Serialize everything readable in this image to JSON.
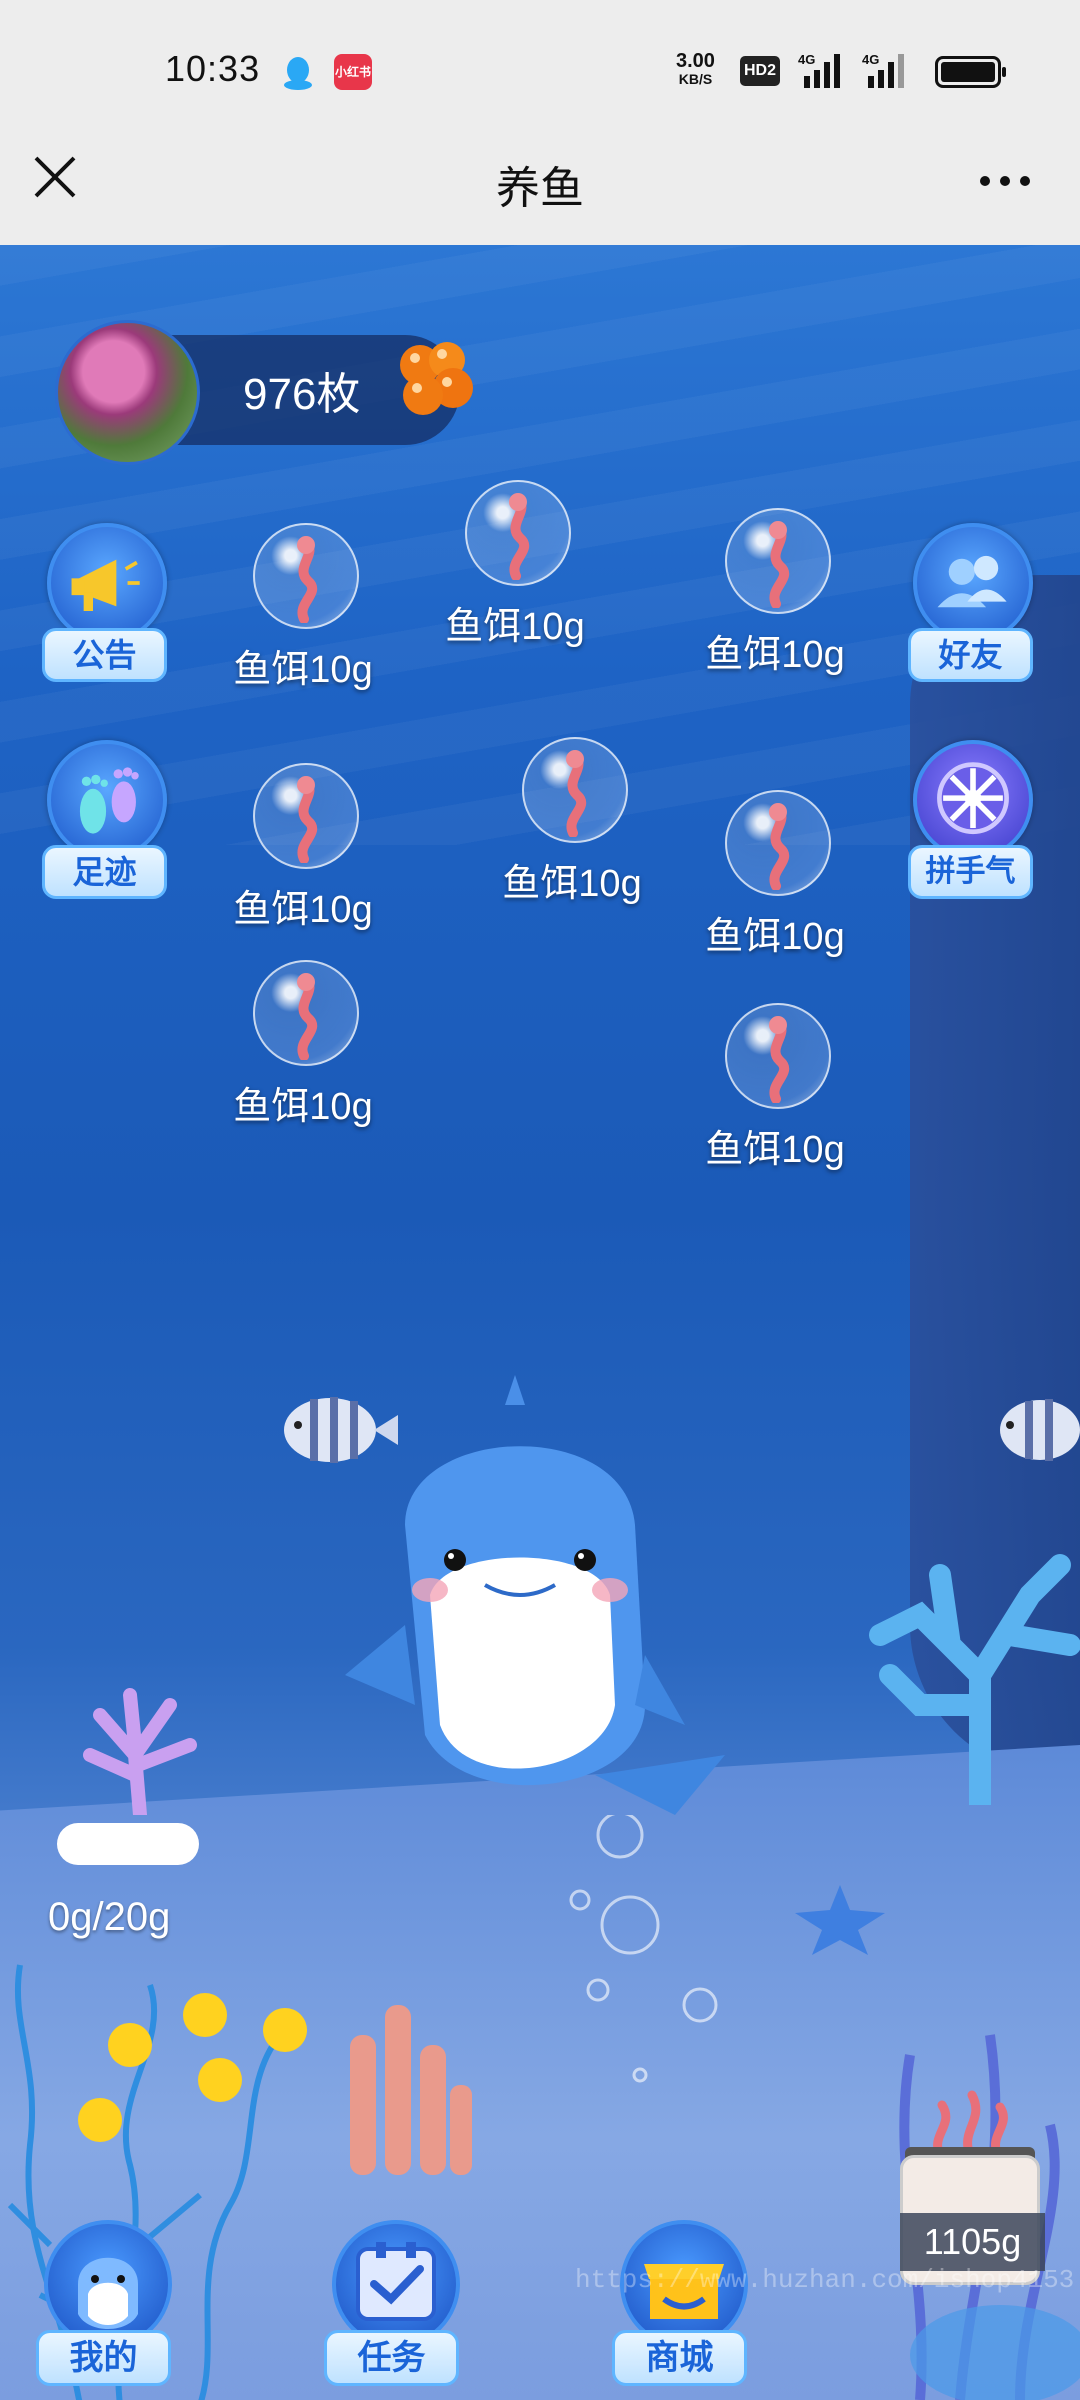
{
  "status": {
    "time": "10:33",
    "net_speed_value": "3.00",
    "net_speed_unit": "KB/S",
    "hd_label": "HD2",
    "signal1_label": "4G",
    "signal2_label": "4G",
    "xhs_label": "小红书"
  },
  "titlebar": {
    "title": "养鱼"
  },
  "user": {
    "coins": "976枚"
  },
  "side_buttons": {
    "notice": "公告",
    "footprint": "足迹",
    "friends": "好友",
    "luck": "拼手气"
  },
  "baits": [
    {
      "label": "鱼饵10g"
    },
    {
      "label": "鱼饵10g"
    },
    {
      "label": "鱼饵10g"
    },
    {
      "label": "鱼饵10g"
    },
    {
      "label": "鱼饵10g"
    },
    {
      "label": "鱼饵10g"
    },
    {
      "label": "鱼饵10g"
    },
    {
      "label": "鱼饵10g"
    }
  ],
  "feeding": {
    "progress_text": "0g/20g",
    "progress_fraction": 0.0
  },
  "bottom_nav": {
    "mine": "我的",
    "tasks": "任务",
    "shop": "商城"
  },
  "bait_stock": "1105g",
  "watermark": "https://www.huzhan.com/ishop4153",
  "colors": {
    "accent": "#1a64d8",
    "label_bg": "#bfe2ff",
    "ocean_top": "#2c77d4",
    "ocean_mid": "#1b5ab7",
    "seabed": "#86a8e4"
  },
  "icons": {
    "close": "close-icon",
    "more": "more-icon",
    "notice": "megaphone-icon",
    "footprint": "footprint-icon",
    "friends": "people-icon",
    "luck": "wheel-icon",
    "bait": "worm-icon",
    "roe": "fish-roe-icon",
    "mine": "dolphin-icon",
    "tasks": "checklist-icon",
    "shop": "shop-icon"
  }
}
